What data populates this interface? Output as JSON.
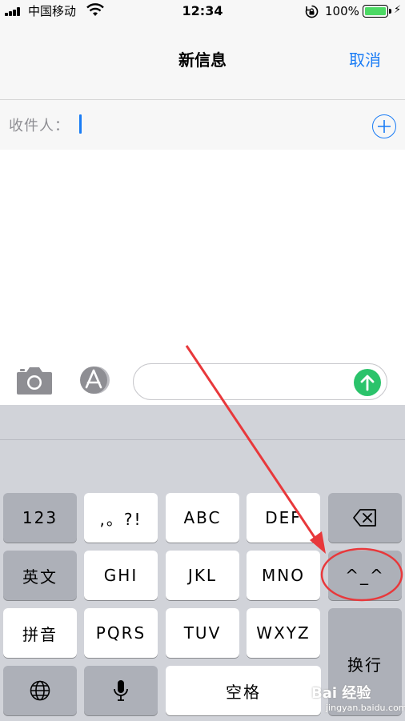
{
  "status_bar": {
    "carrier": "中国移动",
    "time": "12:34",
    "battery_percent": "100%",
    "battery_level": 1.0,
    "icons": [
      "signal-icon",
      "wifi-icon",
      "orientation-lock-icon",
      "battery-icon",
      "charging-bolt-icon"
    ]
  },
  "nav": {
    "title": "新信息",
    "cancel_label": "取消"
  },
  "recipient": {
    "label": "收件人：",
    "value": "",
    "add_icon": "add-contact-icon"
  },
  "compose": {
    "camera_icon": "camera-icon",
    "appstore_icon": "app-store-icon",
    "message_value": "",
    "send_icon": "send-arrow-icon"
  },
  "keyboard": {
    "rows": [
      [
        "123",
        ",。?!",
        "ABC",
        "DEF",
        "delete"
      ],
      [
        "英文",
        "GHI",
        "JKL",
        "MNO",
        "^_^"
      ],
      [
        "拼音",
        "PQRS",
        "TUV",
        "WXYZ"
      ],
      [
        "globe",
        "mic",
        "空格"
      ]
    ],
    "keys": {
      "num": "123",
      "punct": ",。?!",
      "abc": "ABC",
      "def": "DEF",
      "english": "英文",
      "ghi": "GHI",
      "jkl": "JKL",
      "mno": "MNO",
      "emoticon": "^_^",
      "pinyin": "拼音",
      "pqrs": "PQRS",
      "tuv": "TUV",
      "wxyz": "WXYZ",
      "space": "空格",
      "enter": "换行"
    },
    "icons": [
      "delete-icon",
      "globe-icon",
      "microphone-icon"
    ]
  },
  "annotation": {
    "arrow_color": "#e8383b",
    "highlight_color": "#e8383b",
    "target_key": "^_^"
  },
  "watermark": {
    "brand": "Bai 经验",
    "url": "jingyan.baidu.com"
  },
  "colors": {
    "accent": "#1a7cf5",
    "send_green": "#2bc36b",
    "keyboard_bg": "#d1d3d9",
    "dark_key": "#adb0b8",
    "battery_green": "#4cd964"
  }
}
